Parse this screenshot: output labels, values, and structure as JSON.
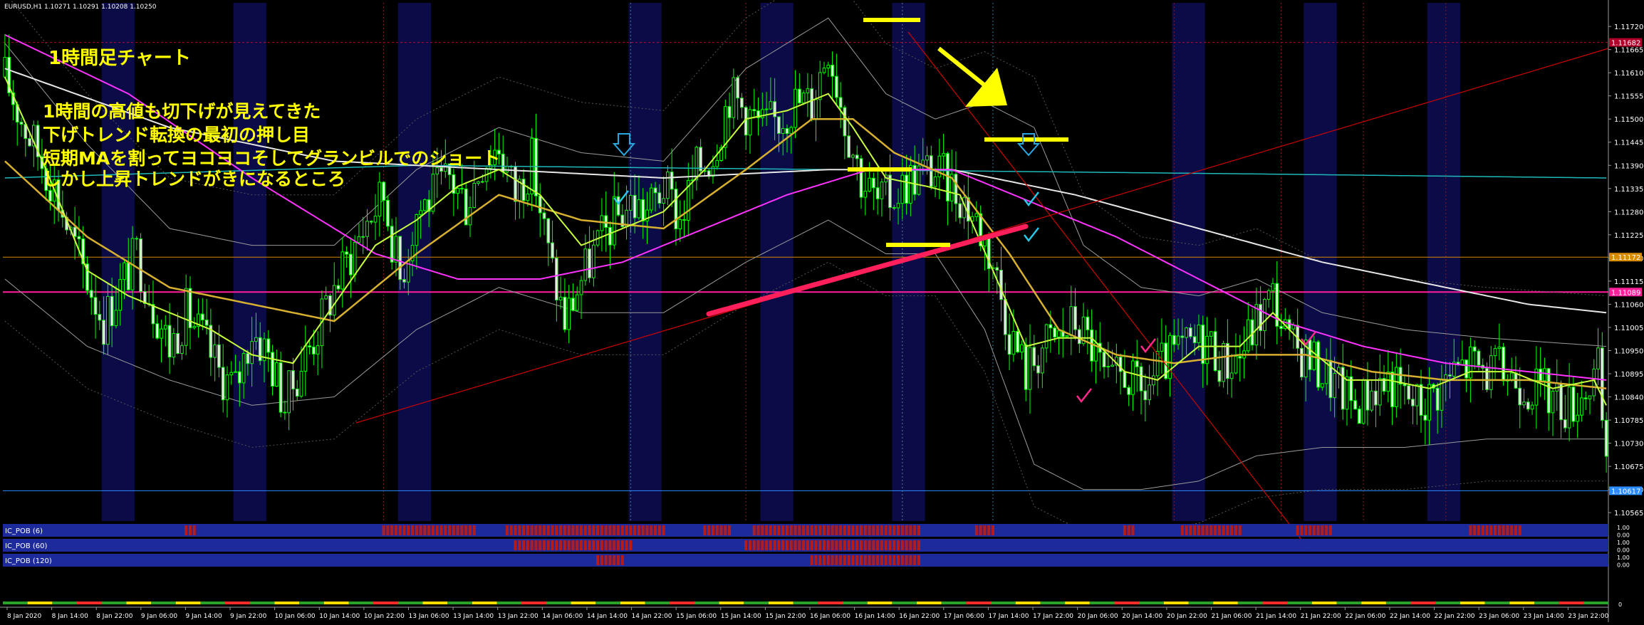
{
  "window": {
    "symbol_header": "EURUSD,H1  1.10271 1.10291 1.10208 1.10250"
  },
  "annotations": {
    "title": "1時間足チャート",
    "lines": [
      "1時間の高値も切下げが見えてきた",
      "下げトレンド転換の最初の押し目",
      "短期MAを割ってヨコヨコそしてグランビルでのショート",
      "しかし上昇トレンドがきになるところ"
    ]
  },
  "colors": {
    "background": "#000000",
    "candle": "#00ff00",
    "ma_short": "#c8ff3c",
    "ma_mid": "#d8b030",
    "ma_long": "#ff33ff",
    "ma_200": "#e6e6e6",
    "ma_cyan": "#1fb8b8",
    "bollinger": "#9a9a9a",
    "session_shade": "#0b0b48",
    "annotation": "#ffff00",
    "trend_red": "#cc0000",
    "bold_trend": "#ff1f5a",
    "level_magenta": "#ff1f9a",
    "level_orange": "#d88a00",
    "level_blue": "#2a8cff",
    "level_top_red": "#b0002a",
    "pob_blue": "#1c2a9c",
    "pob_red": "#b41c1c"
  },
  "chart_data": {
    "type": "candlestick",
    "symbol": "EURUSD",
    "timeframe": "H1",
    "ohlc_header": [
      1.10271,
      1.10291,
      1.10208,
      1.1025
    ],
    "y_ticks": [
      "1.11720",
      "1.11665",
      "1.11610",
      "1.11555",
      "1.11500",
      "1.11445",
      "1.11390",
      "1.11335",
      "1.11280",
      "1.11225",
      "1.11170",
      "1.11115",
      "1.11060",
      "1.11005",
      "1.10950",
      "1.10895",
      "1.10840",
      "1.10785",
      "1.10730",
      "1.10675",
      "1.10620",
      "1.10565"
    ],
    "ylim": [
      1.10545,
      1.11776
    ],
    "level_labels": [
      {
        "label": "1.11682",
        "value": 1.11682,
        "color": "#b0002a"
      },
      {
        "label": "1.11172",
        "value": 1.11172,
        "color": "#d88a00"
      },
      {
        "label": "1.11089",
        "value": 1.11089,
        "color": "#ff1f9a"
      },
      {
        "label": "1.10617",
        "value": 1.10617,
        "color": "#2a8cff"
      }
    ],
    "x_labels": [
      "8 Jan 2020",
      "8 Jan 14:00",
      "8 Jan 22:00",
      "9 Jan 06:00",
      "9 Jan 14:00",
      "9 Jan 22:00",
      "10 Jan 06:00",
      "10 Jan 14:00",
      "10 Jan 22:00",
      "13 Jan 06:00",
      "13 Jan 14:00",
      "13 Jan 22:00",
      "14 Jan 06:00",
      "14 Jan 14:00",
      "14 Jan 22:00",
      "15 Jan 06:00",
      "15 Jan 14:00",
      "15 Jan 22:00",
      "16 Jan 06:00",
      "16 Jan 14:00",
      "16 Jan 22:00",
      "17 Jan 06:00",
      "17 Jan 14:00",
      "17 Jan 22:00",
      "20 Jan 06:00",
      "20 Jan 14:00",
      "20 Jan 22:00",
      "21 Jan 06:00",
      "21 Jan 14:00",
      "21 Jan 22:00",
      "22 Jan 06:00",
      "22 Jan 14:00",
      "22 Jan 22:00",
      "23 Jan 06:00",
      "23 Jan 14:00",
      "23 Jan 22:00"
    ],
    "close_path": [
      [
        0,
        1.116
      ],
      [
        4,
        1.115
      ],
      [
        8,
        1.1142
      ],
      [
        12,
        1.1134
      ],
      [
        16,
        1.1122
      ],
      [
        20,
        1.1112
      ],
      [
        24,
        1.1102
      ],
      [
        28,
        1.111
      ],
      [
        32,
        1.1118
      ],
      [
        36,
        1.1106
      ],
      [
        40,
        1.1096
      ],
      [
        44,
        1.1104
      ],
      [
        48,
        1.1098
      ],
      [
        52,
        1.109
      ],
      [
        56,
        1.1086
      ],
      [
        60,
        1.11
      ],
      [
        64,
        1.1094
      ],
      [
        68,
        1.1082
      ],
      [
        72,
        1.1092
      ],
      [
        76,
        1.11
      ],
      [
        80,
        1.111
      ],
      [
        84,
        1.1118
      ],
      [
        88,
        1.1126
      ],
      [
        92,
        1.1132
      ],
      [
        96,
        1.1112
      ],
      [
        100,
        1.1128
      ],
      [
        104,
        1.1132
      ],
      [
        108,
        1.1136
      ],
      [
        112,
        1.113
      ],
      [
        116,
        1.114
      ],
      [
        120,
        1.1144
      ],
      [
        124,
        1.1132
      ],
      [
        128,
        1.114
      ],
      [
        132,
        1.1118
      ],
      [
        136,
        1.1102
      ],
      [
        140,
        1.1112
      ],
      [
        144,
        1.112
      ],
      [
        148,
        1.1126
      ],
      [
        152,
        1.113
      ],
      [
        156,
        1.1128
      ],
      [
        160,
        1.1134
      ],
      [
        164,
        1.1126
      ],
      [
        168,
        1.1138
      ],
      [
        172,
        1.1142
      ],
      [
        176,
        1.1156
      ],
      [
        180,
        1.1152
      ],
      [
        184,
        1.1148
      ],
      [
        188,
        1.115
      ],
      [
        192,
        1.1154
      ],
      [
        196,
        1.1154
      ],
      [
        200,
        1.1168
      ],
      [
        204,
        1.115
      ],
      [
        208,
        1.1136
      ],
      [
        212,
        1.113
      ],
      [
        216,
        1.1132
      ],
      [
        220,
        1.1136
      ],
      [
        224,
        1.1138
      ],
      [
        228,
        1.1136
      ],
      [
        232,
        1.1132
      ],
      [
        236,
        1.1126
      ],
      [
        240,
        1.1116
      ],
      [
        244,
        1.11
      ],
      [
        248,
        1.109
      ],
      [
        252,
        1.1096
      ],
      [
        256,
        1.1098
      ],
      [
        260,
        1.1102
      ],
      [
        264,
        1.1096
      ],
      [
        268,
        1.1086
      ],
      [
        272,
        1.109
      ],
      [
        276,
        1.1084
      ],
      [
        280,
        1.109
      ],
      [
        284,
        1.1094
      ],
      [
        288,
        1.1096
      ],
      [
        292,
        1.1098
      ],
      [
        296,
        1.1092
      ],
      [
        300,
        1.1094
      ],
      [
        304,
        1.1102
      ],
      [
        308,
        1.1108
      ],
      [
        312,
        1.1096
      ],
      [
        316,
        1.1094
      ],
      [
        320,
        1.109
      ],
      [
        324,
        1.1086
      ],
      [
        328,
        1.1082
      ],
      [
        332,
        1.1086
      ],
      [
        336,
        1.1088
      ],
      [
        340,
        1.1084
      ],
      [
        344,
        1.1082
      ],
      [
        348,
        1.1086
      ],
      [
        352,
        1.109
      ],
      [
        356,
        1.1092
      ],
      [
        360,
        1.109
      ],
      [
        364,
        1.109
      ],
      [
        368,
        1.1088
      ],
      [
        372,
        1.1086
      ],
      [
        376,
        1.1084
      ],
      [
        380,
        1.1082
      ],
      [
        384,
        1.1086
      ],
      [
        387,
        1.109
      ],
      [
        389,
        1.1065
      ]
    ],
    "ma_short": [
      [
        0,
        1.116
      ],
      [
        10,
        1.1138
      ],
      [
        20,
        1.1114
      ],
      [
        30,
        1.1108
      ],
      [
        40,
        1.1104
      ],
      [
        50,
        1.11
      ],
      [
        60,
        1.1094
      ],
      [
        70,
        1.1092
      ],
      [
        80,
        1.1106
      ],
      [
        90,
        1.112
      ],
      [
        100,
        1.1126
      ],
      [
        110,
        1.1134
      ],
      [
        120,
        1.1138
      ],
      [
        130,
        1.1132
      ],
      [
        140,
        1.112
      ],
      [
        150,
        1.1124
      ],
      [
        160,
        1.1128
      ],
      [
        170,
        1.1138
      ],
      [
        180,
        1.115
      ],
      [
        190,
        1.1152
      ],
      [
        200,
        1.1156
      ],
      [
        206,
        1.1148
      ],
      [
        214,
        1.1136
      ],
      [
        224,
        1.1134
      ],
      [
        232,
        1.1132
      ],
      [
        240,
        1.1114
      ],
      [
        248,
        1.1096
      ],
      [
        256,
        1.1098
      ],
      [
        264,
        1.1098
      ],
      [
        272,
        1.109
      ],
      [
        280,
        1.1088
      ],
      [
        290,
        1.1096
      ],
      [
        300,
        1.1096
      ],
      [
        308,
        1.1104
      ],
      [
        316,
        1.1096
      ],
      [
        326,
        1.1088
      ],
      [
        336,
        1.1088
      ],
      [
        346,
        1.1086
      ],
      [
        356,
        1.109
      ],
      [
        366,
        1.109
      ],
      [
        376,
        1.1086
      ],
      [
        386,
        1.1088
      ],
      [
        389,
        1.1082
      ]
    ],
    "ma_mid": [
      [
        0,
        1.114
      ],
      [
        20,
        1.1122
      ],
      [
        40,
        1.111
      ],
      [
        60,
        1.1106
      ],
      [
        80,
        1.1102
      ],
      [
        100,
        1.1118
      ],
      [
        120,
        1.1132
      ],
      [
        140,
        1.1126
      ],
      [
        160,
        1.1124
      ],
      [
        180,
        1.1138
      ],
      [
        196,
        1.115
      ],
      [
        206,
        1.115
      ],
      [
        216,
        1.1142
      ],
      [
        230,
        1.1136
      ],
      [
        244,
        1.1118
      ],
      [
        256,
        1.11
      ],
      [
        270,
        1.1094
      ],
      [
        284,
        1.1092
      ],
      [
        300,
        1.1094
      ],
      [
        316,
        1.1094
      ],
      [
        332,
        1.109
      ],
      [
        350,
        1.1088
      ],
      [
        370,
        1.1088
      ],
      [
        389,
        1.1086
      ]
    ],
    "ma_long": [
      [
        0,
        1.117
      ],
      [
        30,
        1.1156
      ],
      [
        60,
        1.1136
      ],
      [
        90,
        1.1118
      ],
      [
        110,
        1.1112
      ],
      [
        130,
        1.1112
      ],
      [
        150,
        1.1116
      ],
      [
        170,
        1.1124
      ],
      [
        190,
        1.1132
      ],
      [
        210,
        1.1138
      ],
      [
        230,
        1.1138
      ],
      [
        250,
        1.113
      ],
      [
        270,
        1.1122
      ],
      [
        290,
        1.1112
      ],
      [
        310,
        1.1102
      ],
      [
        330,
        1.1096
      ],
      [
        350,
        1.1092
      ],
      [
        370,
        1.109
      ],
      [
        389,
        1.1088
      ]
    ],
    "ma_200": [
      [
        0,
        1.1162
      ],
      [
        40,
        1.1148
      ],
      [
        80,
        1.114
      ],
      [
        120,
        1.1138
      ],
      [
        160,
        1.1136
      ],
      [
        200,
        1.1138
      ],
      [
        230,
        1.1138
      ],
      [
        260,
        1.1132
      ],
      [
        290,
        1.1124
      ],
      [
        320,
        1.1116
      ],
      [
        350,
        1.111
      ],
      [
        370,
        1.1106
      ],
      [
        389,
        1.1104
      ]
    ],
    "ma_cyan": [
      [
        0,
        1.1136
      ],
      [
        100,
        1.1139
      ],
      [
        200,
        1.1138
      ],
      [
        300,
        1.1137
      ],
      [
        389,
        1.1136
      ]
    ],
    "bb_upper": [
      [
        0,
        1.1168
      ],
      [
        20,
        1.1144
      ],
      [
        40,
        1.1124
      ],
      [
        60,
        1.112
      ],
      [
        80,
        1.112
      ],
      [
        100,
        1.1138
      ],
      [
        120,
        1.1148
      ],
      [
        140,
        1.1142
      ],
      [
        160,
        1.114
      ],
      [
        180,
        1.1162
      ],
      [
        200,
        1.1174
      ],
      [
        214,
        1.1156
      ],
      [
        226,
        1.115
      ],
      [
        238,
        1.1154
      ],
      [
        250,
        1.1148
      ],
      [
        262,
        1.112
      ],
      [
        276,
        1.111
      ],
      [
        290,
        1.1108
      ],
      [
        304,
        1.1112
      ],
      [
        320,
        1.1104
      ],
      [
        340,
        1.11
      ],
      [
        360,
        1.1098
      ],
      [
        389,
        1.1096
      ]
    ],
    "bb_lower": [
      [
        0,
        1.1112
      ],
      [
        20,
        1.1096
      ],
      [
        40,
        1.1088
      ],
      [
        60,
        1.1082
      ],
      [
        80,
        1.1084
      ],
      [
        100,
        1.11
      ],
      [
        120,
        1.111
      ],
      [
        140,
        1.1104
      ],
      [
        160,
        1.1104
      ],
      [
        180,
        1.1116
      ],
      [
        200,
        1.1126
      ],
      [
        214,
        1.1118
      ],
      [
        226,
        1.1118
      ],
      [
        238,
        1.11
      ],
      [
        250,
        1.1068
      ],
      [
        262,
        1.1062
      ],
      [
        276,
        1.1062
      ],
      [
        290,
        1.1064
      ],
      [
        304,
        1.107
      ],
      [
        320,
        1.1072
      ],
      [
        340,
        1.1072
      ],
      [
        360,
        1.1074
      ],
      [
        389,
        1.1074
      ]
    ],
    "indicator_rows": [
      {
        "label": "IC_POB (6)",
        "red_ranges": [
          [
            44,
            46
          ],
          [
            92,
            114
          ],
          [
            122,
            160
          ],
          [
            170,
            176
          ],
          [
            182,
            222
          ],
          [
            236,
            240
          ],
          [
            272,
            274
          ],
          [
            286,
            300
          ],
          [
            314,
            322
          ],
          [
            356,
            368
          ]
        ]
      },
      {
        "label": "IC_POB (60)",
        "red_ranges": [
          [
            124,
            152
          ],
          [
            180,
            222
          ]
        ]
      },
      {
        "label": "IC_POB (120)",
        "red_ranges": [
          [
            144,
            150
          ],
          [
            196,
            222
          ]
        ]
      }
    ],
    "right_mini_labels": [
      "1.00",
      "0.00",
      "1.00",
      "0.00",
      "1.00",
      "0.00"
    ],
    "bottom_scale_label": "0"
  }
}
